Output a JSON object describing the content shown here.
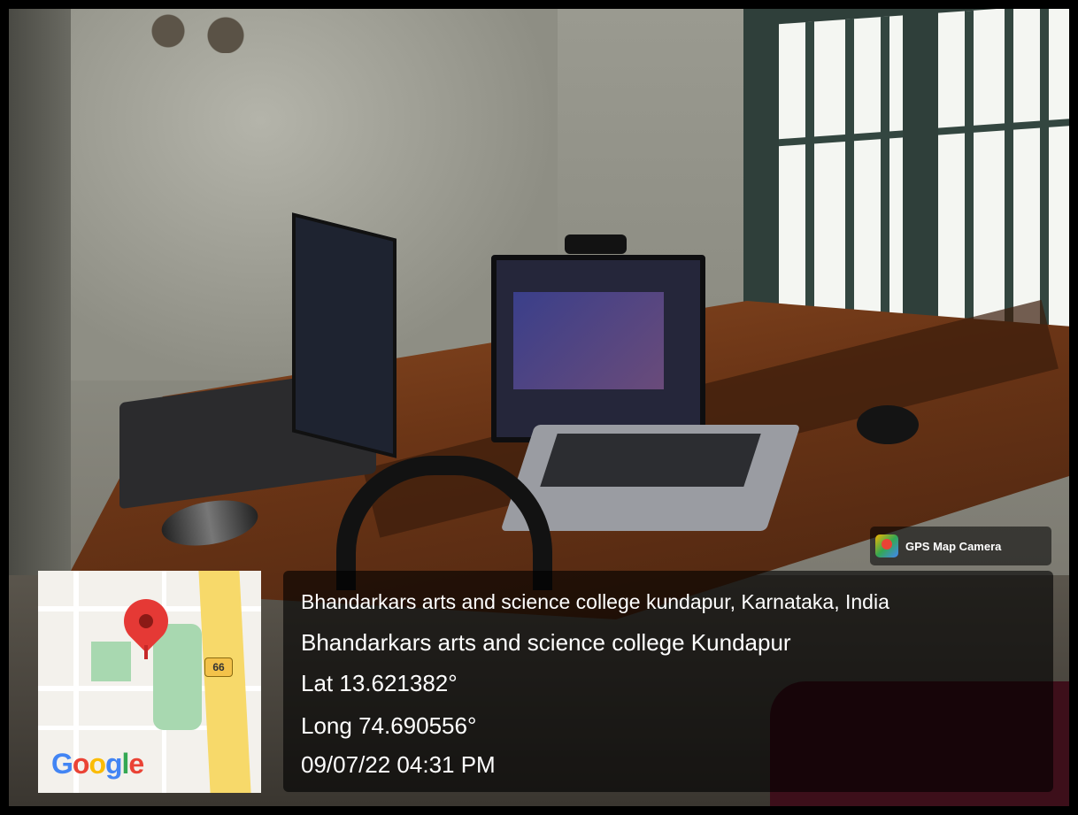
{
  "watermark": {
    "app_name": "GPS Map Camera",
    "icon": "gps-map-camera-app-icon"
  },
  "map": {
    "route_shield": "66",
    "attribution": {
      "g1": "G",
      "g2": "o",
      "g3": "o",
      "g4": "g",
      "g5": "l",
      "g6": "e"
    },
    "pin_icon": "location-pin-icon",
    "colors": {
      "pin": "#e53935",
      "highway": "#f7d96a",
      "park": "#a8d8b0"
    }
  },
  "location": {
    "full_address": "Bhandarkars arts and science college kundapur, Karnataka, India",
    "place_name": "Bhandarkars arts and science college Kundapur",
    "latitude": "Lat 13.621382°",
    "longitude": "Long 74.690556°",
    "timestamp": "09/07/22 04:31 PM"
  }
}
